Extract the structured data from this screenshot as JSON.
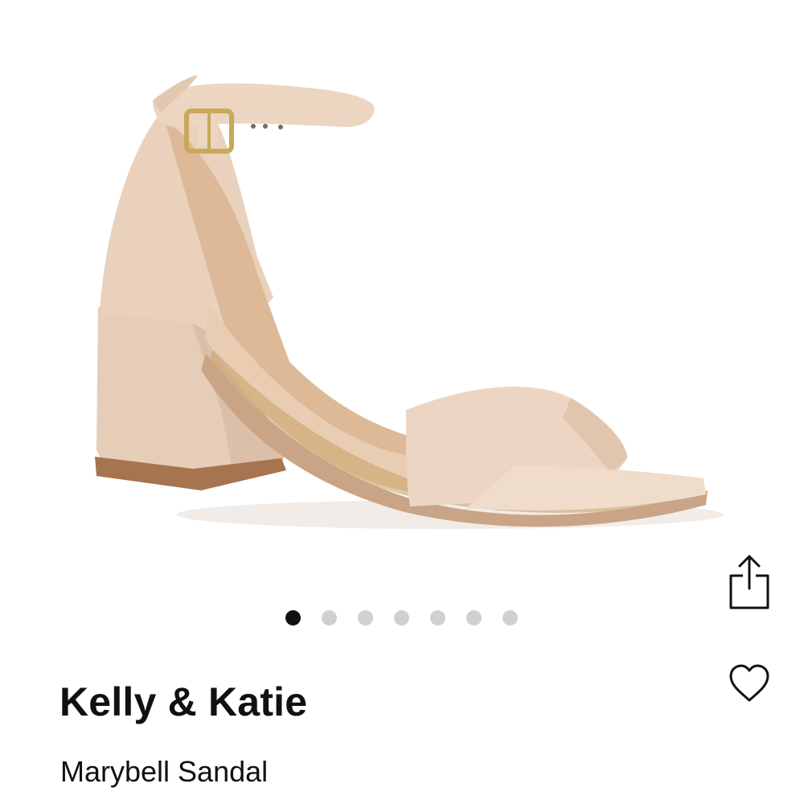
{
  "product": {
    "brand": "Kelly & Katie",
    "name": "Marybell Sandal",
    "image_icon": "product-photo-nude-block-heel-sandal",
    "image_colors": {
      "upper": "#ead3bf",
      "lining": "#dcb99a",
      "sole": "#a77450",
      "buckle": "#c9a85a"
    }
  },
  "actions": {
    "share_icon": "share-icon",
    "wishlist_icon": "heart-icon"
  },
  "carousel": {
    "total_images": 7,
    "active_index": 0
  }
}
